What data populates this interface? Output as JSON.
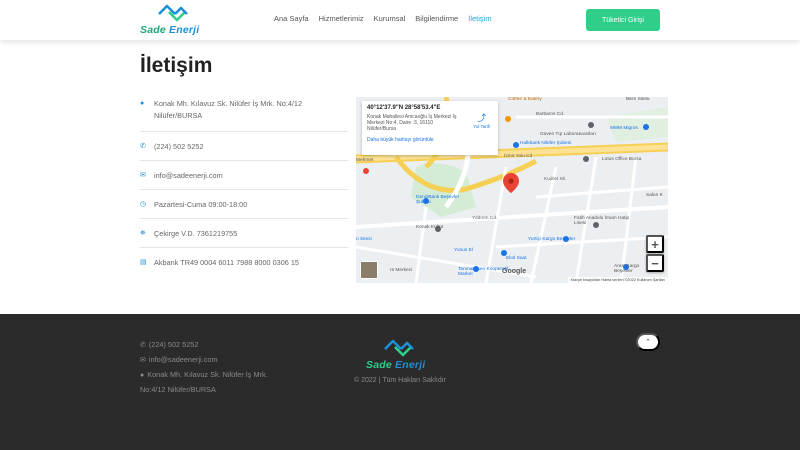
{
  "header": {
    "logo_part1": "Sade",
    "logo_part2": " Enerji",
    "nav": [
      {
        "label": "Ana Sayfa"
      },
      {
        "label": "Hizmetlerimiz"
      },
      {
        "label": "Kurumsal"
      },
      {
        "label": "Bilgilendirme"
      },
      {
        "label": "İletişim"
      }
    ],
    "login_label": "Tüketici Girişi"
  },
  "main": {
    "title": "İletişim",
    "contact": {
      "address": "Konak Mh. Kılavuz Sk. Nilüfer İş Mrk. No:4/12 Nilüfer/BURSA",
      "phone": "(224) 502 5252",
      "email": "info@sadeenerji.com",
      "hours": "Pazartesi-Cuma 09:00-18:00",
      "tax": "Çekirge V.D. 7361219755",
      "iban": "Akbank TR49 0004 6011 7988 8000 0306 15"
    },
    "map": {
      "coord": "40°12'37.9\"N 28°58'53.4\"E",
      "address": "Konak Mahallesi Amcaoğlu İş Merkezi İş Merkezi No:4, Daire :3, 16110 Nilüfer/Bursa",
      "bigger_link": "Daha büyük haritayı görüntüle",
      "directions": "Yol Tarifi",
      "zoom_in": "+",
      "zoom_out": "−",
      "footer_text": "Klavye kısayolları   Harita verileri ©2022   Kullanım Şartları",
      "google": "Google",
      "labels": [
        "Barbaros Cd.",
        "Güven Tıp Laboratuvarları",
        "Halkbank Nilüfer Şubesi",
        "MMM Migros",
        "Lotus Office Bursa",
        "İzmir Yolu Cd",
        "Mehmet",
        "Bilim Sitesi",
        "DenizBank Beşevler Şubesi",
        "Konak Kültür",
        "Fatih Anadolu İmam Hatip Lisesi",
        "Yurtiçi Kargo Beşevler",
        "Yunus El",
        "Ekol Saat",
        "Tanmakosen Kooperatif Market",
        "Arası Kargo Beşevler",
        "Salon K",
        "Kudret Sk.",
        "Yıldırım Cd.",
        "n Sitesi",
        "rs Merkezi",
        "Coffee & Eatery"
      ]
    }
  },
  "footer": {
    "phone": "(224) 502 5252",
    "email": "info@sadeenerji.com",
    "address_line1": "Konak Mh. Kılavuz Sk. Nilüfer İş Mrk.",
    "address_line2": "No:4/12 Nilüfer/BURSA",
    "logo_part1": "Sade",
    "logo_part2": " Enerji",
    "copyright": "© 2022 | Tüm Hakları Saklıdır",
    "to_top": "⌃"
  },
  "colors": {
    "accent_green": "#2fcf8a",
    "accent_blue": "#23a9e1",
    "footer_bg": "#2b2b2b"
  },
  "icons": {
    "address": "map-marker-icon",
    "phone": "phone-icon",
    "email": "envelope-icon",
    "hours": "clock-icon",
    "tax": "bank-icon",
    "iban": "credit-card-icon"
  }
}
